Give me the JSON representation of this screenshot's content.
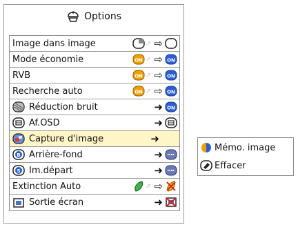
{
  "title": "Options",
  "menu": [
    {
      "label": "Image dans image",
      "icon": "pip-icon"
    },
    {
      "label": "Mode économie",
      "icon": "on-icon"
    },
    {
      "label": "RVB",
      "icon": "on-icon"
    },
    {
      "label": "Recherche auto",
      "icon": "on-icon"
    },
    {
      "label": "Réduction bruit",
      "icon": "noise-icon"
    },
    {
      "label": "Af.OSD",
      "icon": "osd-icon"
    },
    {
      "label": "Capture d'image",
      "icon": "capture-icon"
    },
    {
      "label": "Arrière-fond",
      "icon": "background-icon"
    },
    {
      "label": "Im.départ",
      "icon": "startup-icon"
    },
    {
      "label": "Extinction Auto",
      "icon": "auto-power-off-icon"
    },
    {
      "label": "Sortie écran",
      "icon": "monitor-out-icon"
    }
  ],
  "badges": {
    "on": "ON"
  },
  "submenu": [
    {
      "label": "Mémo. image",
      "icon": "memo-image-icon"
    },
    {
      "label": "Effacer",
      "icon": "erase-icon"
    }
  ],
  "colors": {
    "highlight": "#fff6c8",
    "on_badge": "#f0a000",
    "on_badge_active": "#2b5fcf"
  }
}
